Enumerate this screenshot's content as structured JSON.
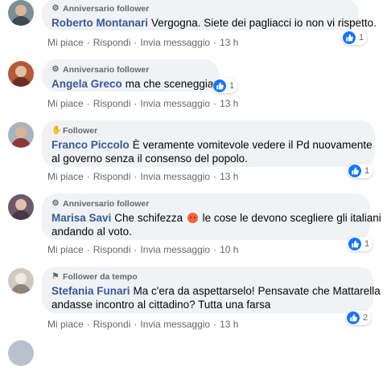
{
  "comments": [
    {
      "badge_icon": "anniversary-icon",
      "badge": "Anniversario follower",
      "author": "Roberto Montanari",
      "text1": "Vergogna. Siete dei pagliacci io non vi rispetto.",
      "text2": "",
      "reaction_count": "1",
      "like": "Mi piace",
      "reply": "Rispondi",
      "message": "Invia messaggio",
      "time": "13 h"
    },
    {
      "badge_icon": "anniversary-icon",
      "badge": "Anniversario follower",
      "author": "Angela Greco",
      "text1": "ma che sceneggiata",
      "text2": "",
      "reaction_count": "1",
      "like": "Mi piace",
      "reply": "Rispondi",
      "message": "Invia messaggio",
      "time": "13 h"
    },
    {
      "badge_icon": "wave-icon",
      "badge": "Follower",
      "author": "Franco Piccolo",
      "text1": "È veramente vomitevole vedere il Pd nuovamente",
      "text2": "al governo senza il consenso del popolo.",
      "reaction_count": "1",
      "like": "Mi piace",
      "reply": "Rispondi",
      "message": "Invia messaggio",
      "time": "13 h"
    },
    {
      "badge_icon": "anniversary-icon",
      "badge": "Anniversario follower",
      "author": "Marisa Savi",
      "text1a": "Che schifezza",
      "text1b": "le cose le devono scegliere gli italiani",
      "text2": "andando al voto.",
      "reaction_count": "1",
      "like": "Mi piace",
      "reply": "Rispondi",
      "message": "Invia messaggio",
      "time": "10 h"
    },
    {
      "badge_icon": "flag-icon",
      "badge": "Follower da tempo",
      "author": "Stefania Funari",
      "text1": "Ma c'era da aspettarselo! Pensavate che Mattarella",
      "text2": "andasse incontro al cittadino? Tutta una farsa",
      "reaction_count": "2",
      "like": "Mi piace",
      "reply": "Rispondi",
      "message": "Invia messaggio",
      "time": "13 h"
    }
  ],
  "colors": {
    "author": "#385898",
    "bubble": "#f0f2f5",
    "like": "#1877f2",
    "meta": "#65676b"
  }
}
